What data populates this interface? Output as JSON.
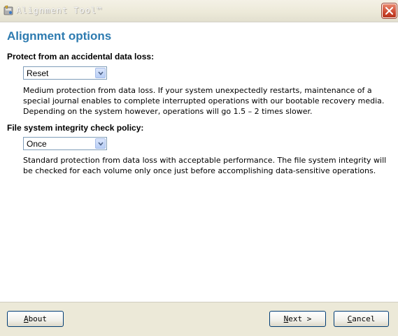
{
  "window": {
    "title": "Alignment Tool™",
    "close_icon": "close-icon",
    "app_icon": "alignment-tool-icon"
  },
  "page": {
    "heading": "Alignment options"
  },
  "protection": {
    "label": "Protect from an accidental data loss:",
    "selected": "Reset",
    "description_lines": [
      "Medium protection from data loss. If your system unexpectedly restarts, maintenance of a",
      "special journal enables to complete interrupted operations with our bootable recovery media.",
      "Depending on the system however, operations will go 1.5 – 2 times slower."
    ]
  },
  "integrity": {
    "label": "File system integrity check policy:",
    "selected": "Once",
    "description_lines": [
      "Standard protection from data loss with acceptable performance. The file system integrity will",
      "be checked for each volume only once just before accomplishing data-sensitive operations."
    ]
  },
  "footer": {
    "about": {
      "first": "A",
      "rest": "bout"
    },
    "next": {
      "first": "N",
      "rest": "ext >"
    },
    "cancel": {
      "first": "C",
      "rest": "ancel"
    }
  }
}
